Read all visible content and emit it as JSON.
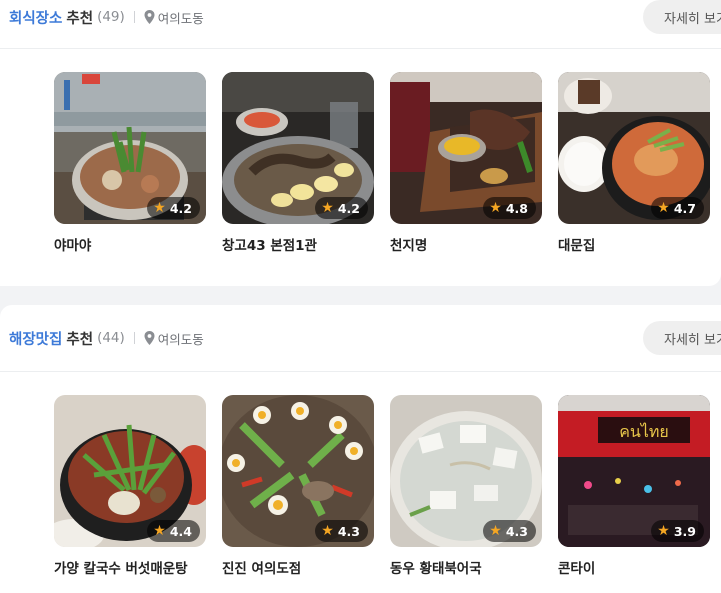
{
  "sections": [
    {
      "keyword": "회식장소",
      "label": "추천",
      "count": "(49)",
      "location": "여의도동",
      "more": "자세히 보기",
      "places": [
        {
          "name": "야마야",
          "rating": "4.2"
        },
        {
          "name": "창고43 본점1관",
          "rating": "4.2"
        },
        {
          "name": "천지명",
          "rating": "4.8"
        },
        {
          "name": "대문집",
          "rating": "4.7"
        }
      ]
    },
    {
      "keyword": "해장맛집",
      "label": "추천",
      "count": "(44)",
      "location": "여의도동",
      "more": "자세히 보기",
      "places": [
        {
          "name": "가양 칼국수 버섯매운탕",
          "rating": "4.4"
        },
        {
          "name": "진진 여의도점",
          "rating": "4.3"
        },
        {
          "name": "동우 황태북어국",
          "rating": "4.3"
        },
        {
          "name": "콘타이",
          "rating": "3.9"
        }
      ]
    }
  ],
  "icons": {
    "location": "map-pin-icon",
    "rating": "star-icon"
  },
  "colors": {
    "keyword": "#3d7ad8",
    "star": "#f5a623"
  }
}
